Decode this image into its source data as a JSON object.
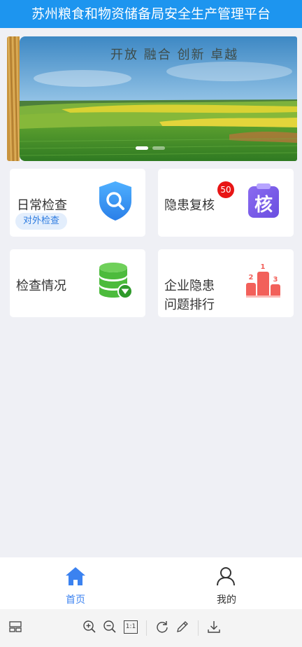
{
  "header": {
    "title": "苏州粮食和物资储备局安全生产管理平台"
  },
  "banner": {
    "slogan": "开放 融合 创新 卓越",
    "slide_count": 2,
    "active_slide": 1
  },
  "cards": [
    {
      "title": "日常检查",
      "tag": "对外检查",
      "icon": "shield-search-icon"
    },
    {
      "title": "隐患复核",
      "badge": "50",
      "icon": "review-stamp-icon",
      "icon_text": "核"
    },
    {
      "title": "检查情况",
      "icon": "database-filter-icon"
    },
    {
      "title_line1": "企业隐患",
      "title_line2": "问题排行",
      "icon": "podium-ranking-icon",
      "rank_labels": [
        "1",
        "2",
        "3"
      ]
    }
  ],
  "tabbar": {
    "items": [
      {
        "label": "首页",
        "icon": "home-icon",
        "active": true
      },
      {
        "label": "我的",
        "icon": "user-icon",
        "active": false
      }
    ],
    "active_color": "#3b82f0",
    "inactive_color": "#333333"
  },
  "toolbar": {
    "items": [
      "layout-icon",
      "zoom-in-icon",
      "zoom-out-icon",
      "actual-size-icon",
      "rotate-icon",
      "edit-icon",
      "download-icon"
    ],
    "actual_size_label": "1:1"
  },
  "colors": {
    "header_bg": "#1d95ef",
    "badge": "#e81515",
    "tag_text": "#2c7be0",
    "page_bg": "#eff0f5"
  }
}
